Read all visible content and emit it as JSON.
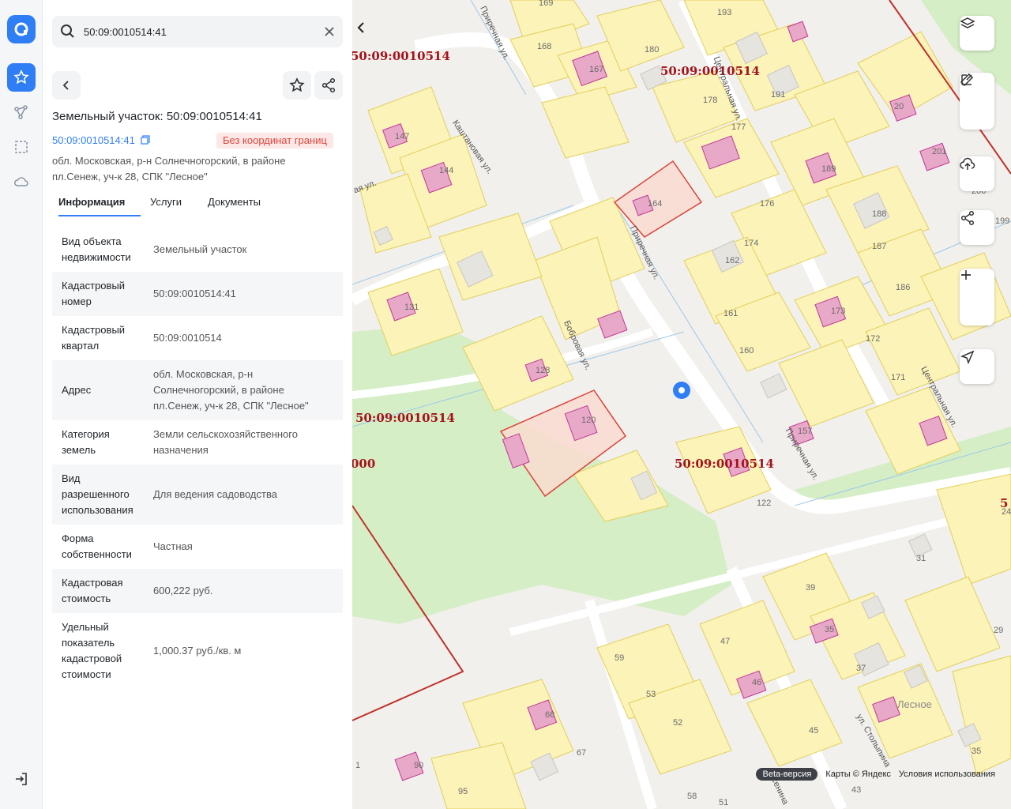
{
  "search": {
    "query": "50:09:0010514:41"
  },
  "object": {
    "title": "Земельный участок: 50:09:0010514:41",
    "cad_link": "50:09:0010514:41",
    "badge": "Без координат границ",
    "address": "обл. Московская, р-н Солнечногорский, в районе пл.Сенеж, уч-к 28, СПК \"Лесное\""
  },
  "tabs": [
    "Информация",
    "Услуги",
    "Документы"
  ],
  "properties": [
    {
      "k": "Вид объекта недвижимости",
      "v": "Земельный участок"
    },
    {
      "k": "Кадастровый номер",
      "v": "50:09:0010514:41"
    },
    {
      "k": "Кадастровый квартал",
      "v": "50:09:0010514"
    },
    {
      "k": "Адрес",
      "v": "обл. Московская, р-н Солнечногорский, в районе пл.Сенеж, уч-к 28, СПК \"Лесное\""
    },
    {
      "k": "Категория земель",
      "v": "Земли сельскохозяйственного назначения"
    },
    {
      "k": "Вид разрешенного использования",
      "v": "Для ведения садоводства"
    },
    {
      "k": "Форма собственности",
      "v": "Частная"
    },
    {
      "k": "Кадастровая стоимость",
      "v": "600,222 руб."
    },
    {
      "k": "Удельный показатель кадастровой стоимости",
      "v": "1,000.37 руб./кв. м"
    }
  ],
  "map": {
    "quarter_labels": [
      "50:09:0010514",
      "50:09:0010514",
      "50:09:0010514",
      "50:09:0010514",
      "000",
      "5"
    ],
    "plot_numbers": [
      "169",
      "168",
      "167",
      "180",
      "193",
      "191",
      "178",
      "177",
      "20",
      "201",
      "200",
      "199",
      "147",
      "144",
      "164",
      "176",
      "189",
      "188",
      "174",
      "162",
      "187",
      "186",
      "161",
      "131",
      "173",
      "172",
      "160",
      "171",
      "128",
      "120",
      "157",
      "122",
      "31",
      "24",
      "39",
      "47",
      "35",
      "37",
      "29",
      "59",
      "53",
      "46",
      "52",
      "45",
      "68",
      "67",
      "35",
      "90",
      "95",
      "43",
      "58",
      "51",
      "1",
      "Лесное"
    ],
    "streets": [
      "Приречная ул.",
      "Центральная ул.",
      "Каштановая ул.",
      "Приречная ул.",
      "Бобровая ул.",
      "Приречная ул.",
      "Центральная ул.",
      "ул. Столыпина",
      "Есенина",
      "ая ул."
    ],
    "beta": "Beta-версия",
    "attribution": "Карты © Яндекс",
    "terms": "Условия использования"
  }
}
